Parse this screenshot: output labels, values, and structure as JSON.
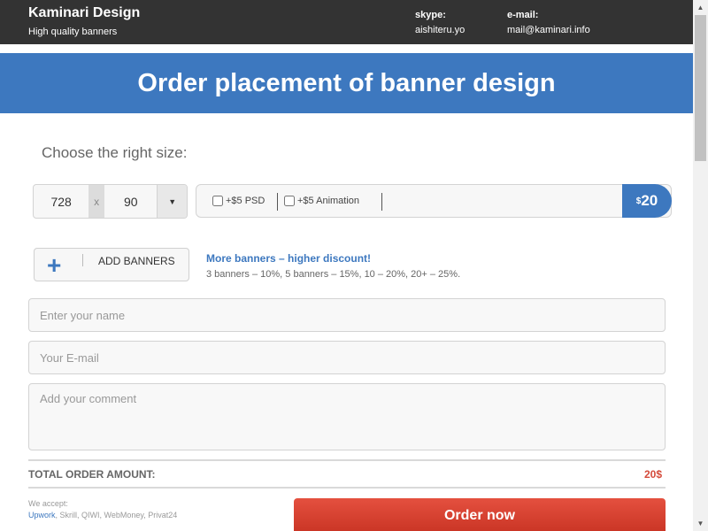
{
  "header": {
    "brand": "Kaminari Design",
    "tagline": "High quality banners",
    "skype_label": "skype:",
    "skype_value": "aishiteru.yo",
    "email_label": "e-mail:",
    "email_value": "mail@kaminari.info"
  },
  "banner": {
    "title": "Order placement of banner design"
  },
  "size": {
    "heading": "Choose the right size:",
    "width": "728",
    "separator": "x",
    "height": "90",
    "dropdown_icon": "triangle-down-icon"
  },
  "options": {
    "psd_label": "+$5 PSD",
    "animation_label": "+$5 Animation",
    "price_currency": "$",
    "price_value": "20"
  },
  "add": {
    "button_label": "ADD BANNERS",
    "promo_title": "More banners – higher discount!",
    "promo_text": "3 banners – 10%, 5 banners – 15%, 10 – 20%, 20+ – 25%."
  },
  "form": {
    "name_placeholder": "Enter your name",
    "email_placeholder": "Your E-mail",
    "comment_placeholder": "Add your comment"
  },
  "total": {
    "label": "TOTAL ORDER AMOUNT:",
    "value": "20$"
  },
  "payment": {
    "accept_label": "We accept:",
    "methods_primary": "Upwork",
    "methods_rest": ", Skrill, QIWI, WebMoney, Privat24"
  },
  "order": {
    "button_label": "Order now"
  },
  "colors": {
    "accent": "#3d78bf",
    "header_bg": "#333333",
    "cta": "#d8412f"
  }
}
